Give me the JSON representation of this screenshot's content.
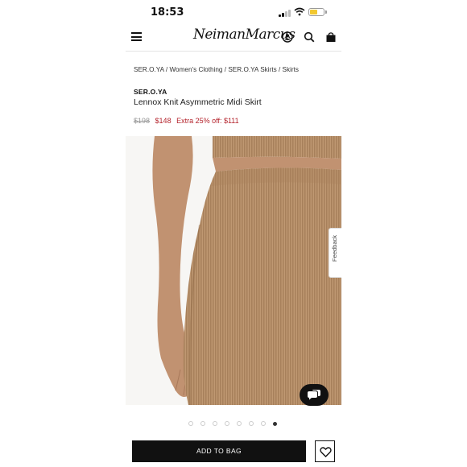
{
  "status_bar": {
    "time": "18:53",
    "battery_level": 0.55,
    "battery_color": "#f2c830"
  },
  "header": {
    "logo_text": "NeimanMarcus",
    "icons": [
      "menu-icon",
      "account-icon",
      "search-icon",
      "shopping-bag-icon"
    ]
  },
  "breadcrumb": {
    "items": [
      "SER.O.YA",
      "Women's Clothing",
      "SER.O.YA Skirts",
      "Skirts"
    ],
    "separator": " / "
  },
  "product": {
    "brand": "SER.O.YA",
    "name": "Lennox Knit Asymmetric Midi Skirt",
    "price_original": "$198",
    "price_sale": "$148",
    "price_extra": "Extra 25% off: $111",
    "sale_color": "#b4232c",
    "image_description_colors": {
      "knit": "#b78f68",
      "skin": "#c19271"
    }
  },
  "feedback": {
    "label": "Feedback"
  },
  "chat": {
    "icon": "chat-icon"
  },
  "carousel": {
    "total": 8,
    "active_index": 7
  },
  "actions": {
    "add_to_bag_label": "ADD TO BAG",
    "wishlist_icon": "heart-icon"
  }
}
